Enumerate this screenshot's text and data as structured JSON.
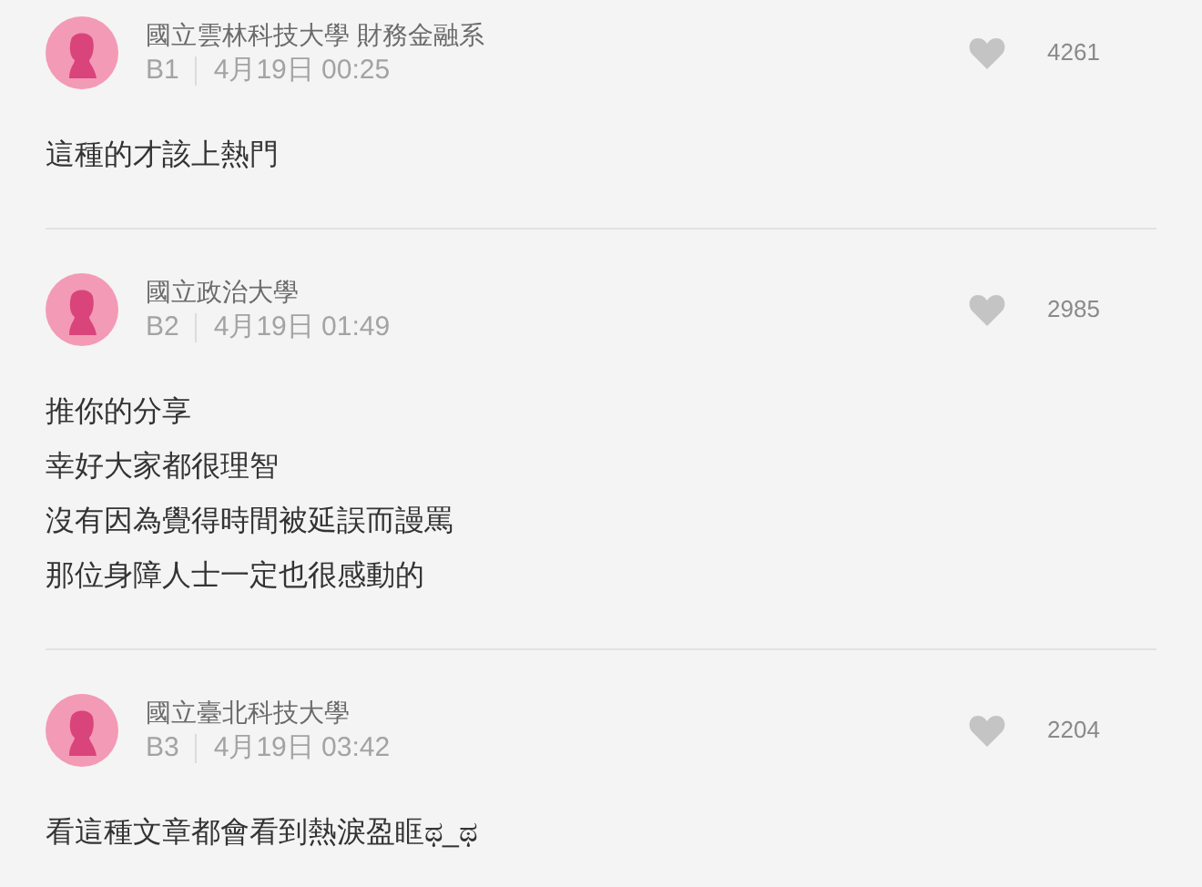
{
  "comments": [
    {
      "school": "國立雲林科技大學 財務金融系",
      "floor": "B1",
      "time": "4月19日 00:25",
      "likes": "4261",
      "lines": [
        "這種的才該上熱門"
      ]
    },
    {
      "school": "國立政治大學",
      "floor": "B2",
      "time": "4月19日 01:49",
      "likes": "2985",
      "lines": [
        "推你的分享",
        "幸好大家都很理智",
        "沒有因為覺得時間被延誤而謾罵",
        "那位身障人士一定也很感動的"
      ]
    },
    {
      "school": "國立臺北科技大學",
      "floor": "B3",
      "time": "4月19日 03:42",
      "likes": "2204",
      "lines": [
        "看這種文章都會看到熱淚盈眶ಥ_ಥ"
      ]
    }
  ]
}
